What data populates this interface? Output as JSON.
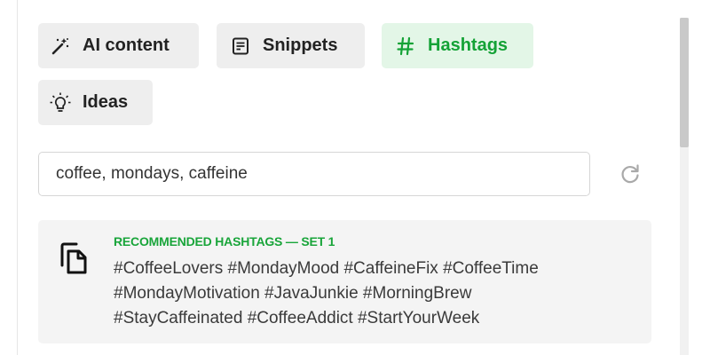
{
  "tabs": {
    "ai_content": {
      "label": "AI content",
      "icon": "magic-wand-icon"
    },
    "snippets": {
      "label": "Snippets",
      "icon": "document-icon"
    },
    "hashtags": {
      "label": "Hashtags",
      "icon": "hashtag-icon",
      "active": true
    },
    "ideas": {
      "label": "Ideas",
      "icon": "lightbulb-icon"
    }
  },
  "search": {
    "value": "coffee, mondays, caffeine",
    "refresh_icon": "refresh-icon"
  },
  "result": {
    "title": "RECOMMENDED HASHTAGS — SET 1",
    "copy_icon": "copy-icon",
    "lines": [
      "#CoffeeLovers #MondayMood #CaffeineFix #CoffeeTime",
      "#MondayMotivation #JavaJunkie #MorningBrew",
      "#StayCaffeinated #CoffeeAddict #StartYourWeek"
    ]
  },
  "colors": {
    "accent": "#19a53a",
    "active_tab_bg": "#e3f6e7",
    "tab_bg": "#eeeeee",
    "card_bg": "#f4f4f4"
  }
}
